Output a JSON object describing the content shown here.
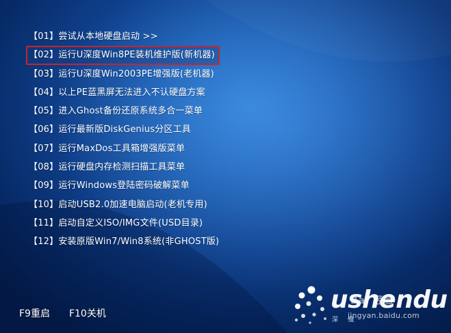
{
  "menu": {
    "items": [
      {
        "label": "【01】尝试从本地硬盘启动 >>",
        "selected": false
      },
      {
        "label": "【02】运行U深度Win8PE装机维护版(新机器)",
        "selected": true
      },
      {
        "label": "【03】运行U深度Win2003PE增强版(老机器)",
        "selected": false
      },
      {
        "label": "【04】以上PE蓝黑屏无法进入不认硬盘方案",
        "selected": false
      },
      {
        "label": "【05】进入Ghost备份还原系统多合一菜单",
        "selected": false
      },
      {
        "label": "【06】运行最新版DiskGenius分区工具",
        "selected": false
      },
      {
        "label": "【07】运行MaxDos工具箱增强版菜单",
        "selected": false
      },
      {
        "label": "【08】运行硬盘内存检测扫描工具菜单",
        "selected": false
      },
      {
        "label": "【09】运行Windows登陆密码破解菜单",
        "selected": false
      },
      {
        "label": "【10】启动USB2.0加速电脑启动(老机专用)",
        "selected": false
      },
      {
        "label": "【11】启动自定义ISO/IMG文件(USD目录)",
        "selected": false
      },
      {
        "label": "【12】安装原版Win7/Win8系统(非GHOST版)",
        "selected": false
      }
    ]
  },
  "footer": {
    "reboot_label": "F9重启",
    "shutdown_label": "F10关机"
  },
  "logo": {
    "wordmark": "ushendu",
    "subtitle": "深 度"
  },
  "watermark": {
    "title": "Bai 经验",
    "url": "jingyan.baidu.com"
  },
  "colors": {
    "selection_border": "#c8242c",
    "text": "#ffffff",
    "background_dark": "#041d4c",
    "background_light": "#2f7fd2"
  }
}
